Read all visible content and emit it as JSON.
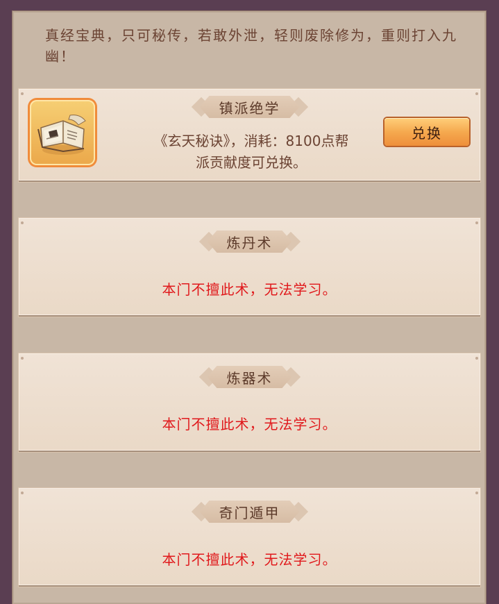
{
  "intro_text": "真经宝典，只可秘传，若敢外泄，轻则废除修为，重则打入九幽！",
  "featured": {
    "title": "镇派绝学",
    "description_line1": "《玄天秘诀》，消耗：8100点帮",
    "description_line2": "派贡献度可兑换。",
    "button_label": "兑换",
    "icon": "scroll-book-icon"
  },
  "skills": [
    {
      "title": "炼丹术",
      "message": "本门不擅此术，无法学习。"
    },
    {
      "title": "炼器术",
      "message": "本门不擅此术，无法学习。"
    },
    {
      "title": "奇门遁甲",
      "message": "本门不擅此术，无法学习。"
    }
  ],
  "colors": {
    "warning_text": "#e0181b",
    "accent_button": "#f5a94f"
  }
}
